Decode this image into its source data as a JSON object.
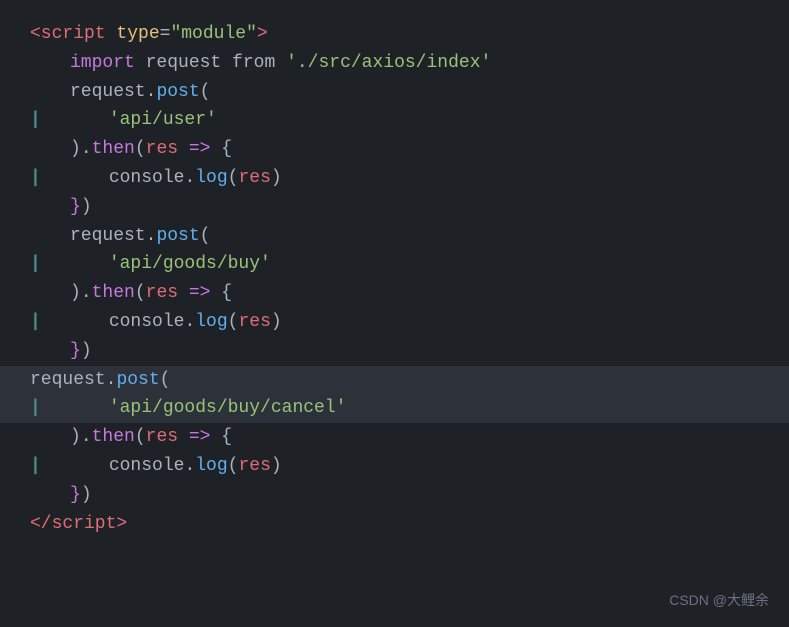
{
  "code": {
    "lines": [
      {
        "id": "line1",
        "type": "tag-line",
        "content": "<script type=\"module\">"
      },
      {
        "id": "line2",
        "type": "import",
        "indent": 1
      },
      {
        "id": "line3",
        "type": "request-post-1",
        "indent": 0
      },
      {
        "id": "line4",
        "type": "bar-string",
        "indent": 2,
        "value": "'api/user'"
      },
      {
        "id": "line5",
        "type": "then-1",
        "indent": 0
      },
      {
        "id": "line6",
        "type": "console-1",
        "indent": 2
      },
      {
        "id": "line7",
        "type": "close-1",
        "indent": 0
      },
      {
        "id": "line8",
        "type": "request-post-2",
        "indent": 0
      },
      {
        "id": "line9",
        "type": "bar-string-2",
        "indent": 2,
        "value": "'api/goods/buy'"
      },
      {
        "id": "line10",
        "type": "then-2",
        "indent": 0
      },
      {
        "id": "line11",
        "type": "console-2",
        "indent": 2
      },
      {
        "id": "line12",
        "type": "close-2",
        "indent": 0
      },
      {
        "id": "line13",
        "type": "request-post-3",
        "indent": 0,
        "highlighted": true
      },
      {
        "id": "line14",
        "type": "bar-string-3",
        "indent": 2,
        "value": "'api/goods/buy/cancel'",
        "highlighted": true
      },
      {
        "id": "line15",
        "type": "then-3",
        "indent": 0
      },
      {
        "id": "line16",
        "type": "console-3",
        "indent": 2
      },
      {
        "id": "line17",
        "type": "close-3",
        "indent": 0
      },
      {
        "id": "line18",
        "type": "closing-tag"
      }
    ],
    "watermark": "CSDN @大鲤余"
  }
}
